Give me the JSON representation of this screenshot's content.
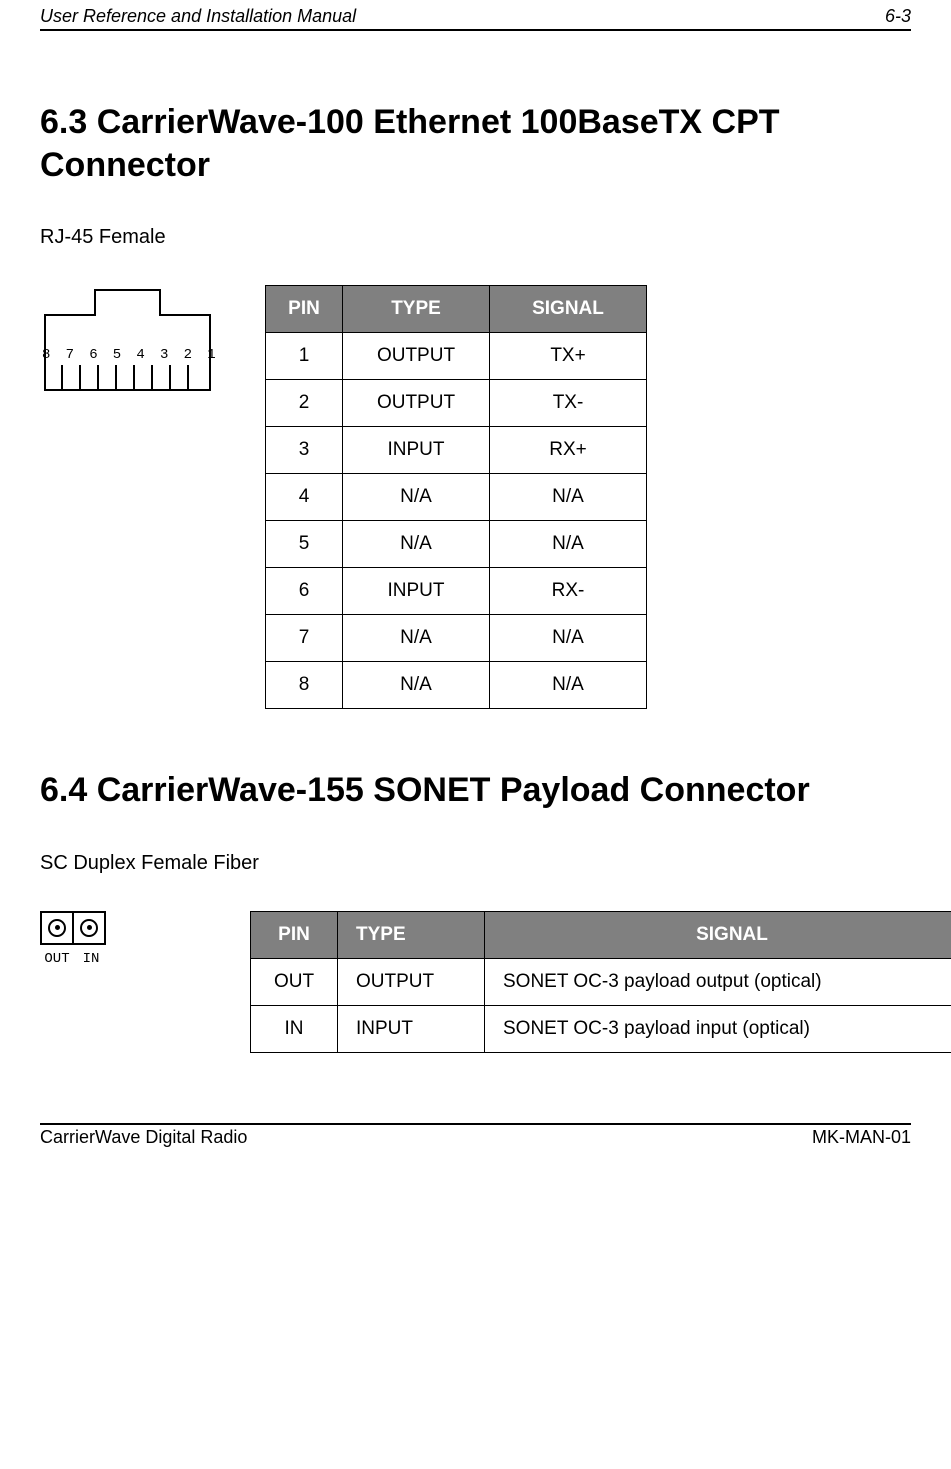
{
  "header": {
    "left": "User Reference and Installation Manual",
    "right": "6-3"
  },
  "section63": {
    "title": "6.3 CarrierWave-100 Ethernet 100BaseTX CPT Connector",
    "subtitle": "RJ-45 Female",
    "rj45_pin_labels": "8 7 6 5 4 3 2 1",
    "table": {
      "headers": {
        "pin": "PIN",
        "type": "TYPE",
        "signal": "SIGNAL"
      },
      "rows": [
        {
          "pin": "1",
          "type": "OUTPUT",
          "signal": "TX+"
        },
        {
          "pin": "2",
          "type": "OUTPUT",
          "signal": "TX-"
        },
        {
          "pin": "3",
          "type": "INPUT",
          "signal": "RX+"
        },
        {
          "pin": "4",
          "type": "N/A",
          "signal": "N/A"
        },
        {
          "pin": "5",
          "type": "N/A",
          "signal": "N/A"
        },
        {
          "pin": "6",
          "type": "INPUT",
          "signal": "RX-"
        },
        {
          "pin": "7",
          "type": "N/A",
          "signal": "N/A"
        },
        {
          "pin": "8",
          "type": "N/A",
          "signal": "N/A"
        }
      ]
    }
  },
  "section64": {
    "title": "6.4 CarrierWave-155 SONET Payload Connector",
    "subtitle": "SC Duplex Female Fiber",
    "port_labels": {
      "out": "OUT",
      "in": "IN"
    },
    "table": {
      "headers": {
        "pin": "PIN",
        "type": "TYPE",
        "signal": "SIGNAL"
      },
      "rows": [
        {
          "pin": "OUT",
          "type": "OUTPUT",
          "signal": "SONET OC-3 payload output (optical)"
        },
        {
          "pin": "IN",
          "type": "INPUT",
          "signal": "SONET OC-3 payload input (optical)"
        }
      ]
    }
  },
  "footer": {
    "left": "CarrierWave Digital Radio",
    "right": "MK-MAN-01"
  }
}
